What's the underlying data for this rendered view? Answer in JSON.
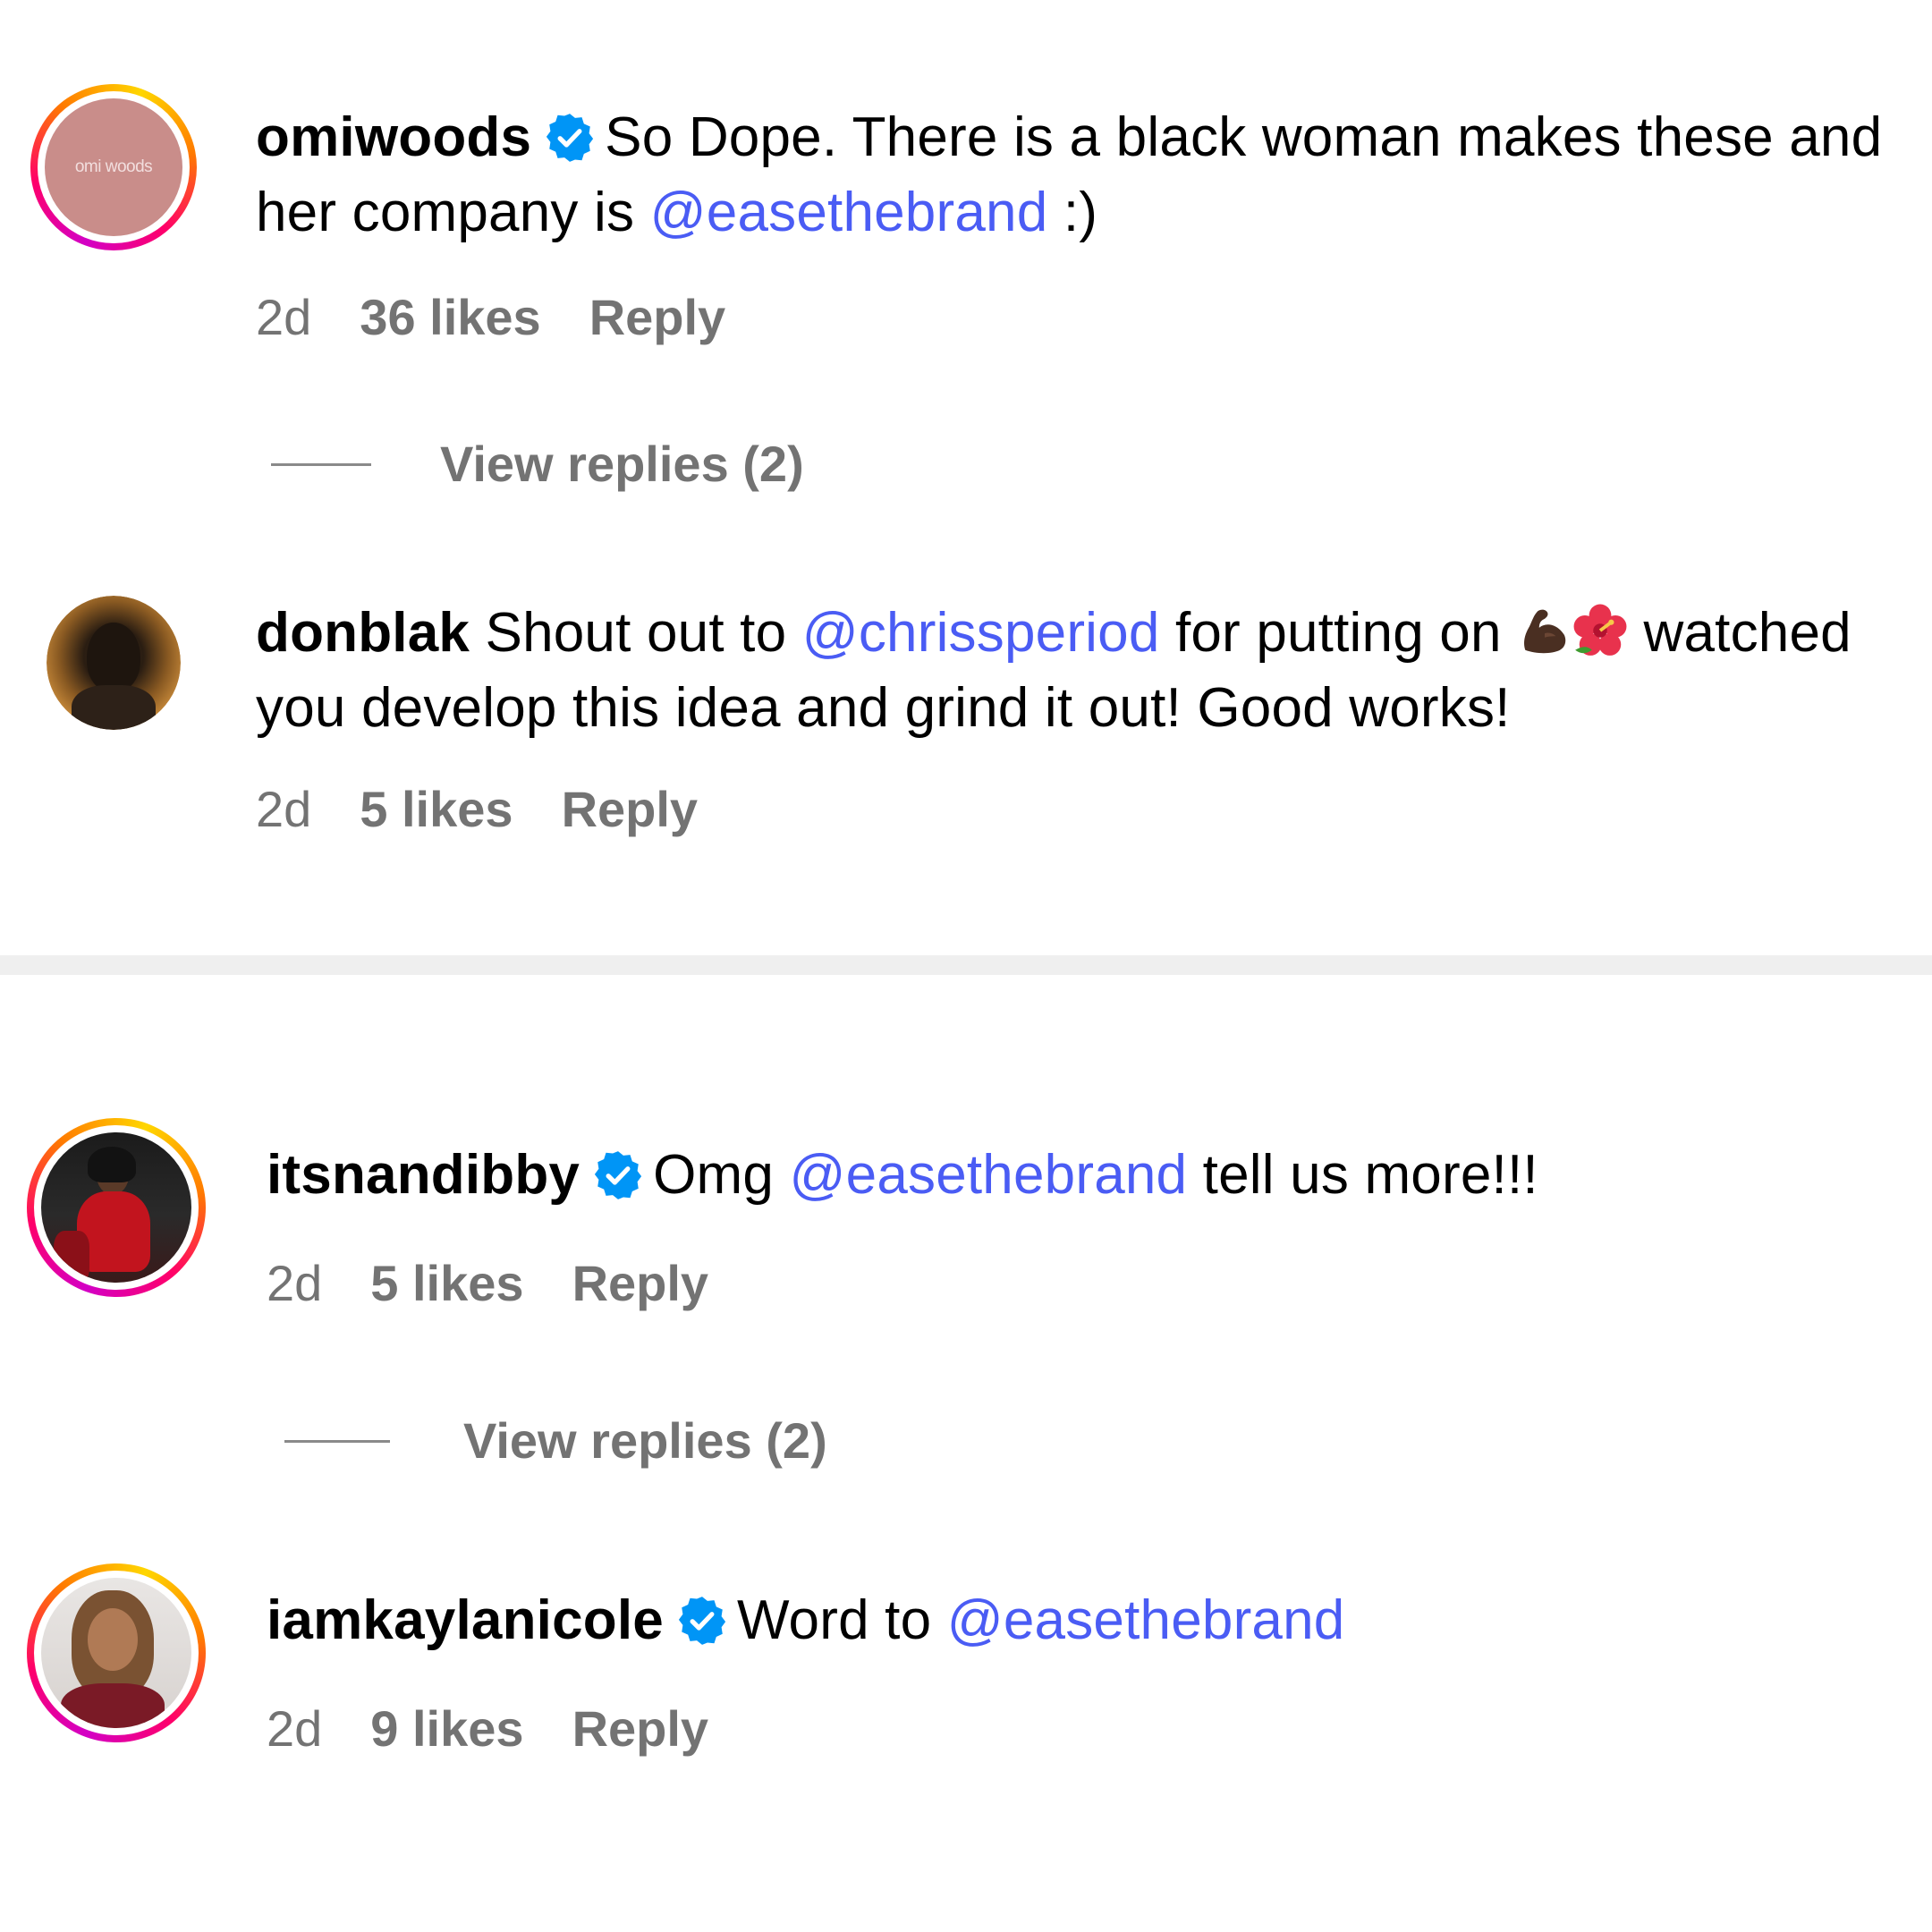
{
  "comments": [
    {
      "username": "omiwoods",
      "verified": true,
      "avatar_label": "omi woods",
      "text_before": "So Dope. There is a black woman makes these and her company is ",
      "mention": "@easethebrand",
      "text_after": " :)",
      "time": "2d",
      "likes": "36 likes",
      "reply": "Reply",
      "view_replies": "View replies (2)"
    },
    {
      "username": "donblak",
      "verified": false,
      "text_before": "Shout out to ",
      "mention": "@chrissperiod",
      "text_after": " for putting on ",
      "text_end": " watched you develop this idea and grind it out! Good works!",
      "emojis": [
        "flexed-biceps-icon",
        "hibiscus-icon"
      ],
      "time": "2d",
      "likes": "5 likes",
      "reply": "Reply"
    },
    {
      "username": "itsnandibby",
      "verified": true,
      "text_before": "Omg ",
      "mention": "@easethebrand",
      "text_after": " tell us more!!!",
      "time": "2d",
      "likes": "5 likes",
      "reply": "Reply",
      "view_replies": "View replies (2)"
    },
    {
      "username": "iamkaylanicole",
      "verified": true,
      "text_before": "Word to ",
      "mention": "@easethebrand",
      "text_after": "",
      "time": "2d",
      "likes": "9 likes",
      "reply": "Reply"
    }
  ],
  "colors": {
    "mention": "#4a5cf4",
    "meta": "#737373",
    "verified": "#0095f6",
    "divider": "#efefef"
  }
}
